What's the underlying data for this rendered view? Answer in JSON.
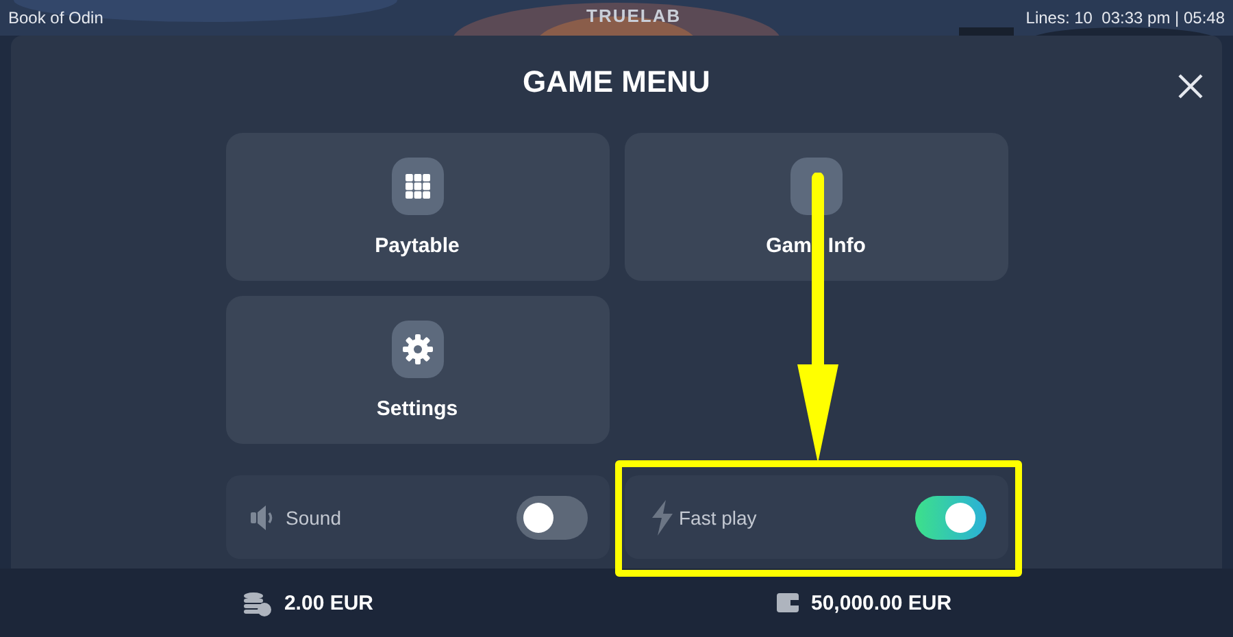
{
  "header": {
    "game_title": "Book of Odin",
    "logo": "TRUELAB",
    "status": "Lines: 10  03:33 pm | 05:48"
  },
  "menu": {
    "title": "GAME MENU",
    "items": [
      {
        "label": "Paytable",
        "kind": "grid"
      },
      {
        "label_parts": [
          "Gam",
          "Info"
        ],
        "kind": "blank"
      },
      {
        "label": "Settings",
        "kind": "gear"
      }
    ]
  },
  "toggles": [
    {
      "label": "Sound",
      "kind": "sound",
      "on": false,
      "highlighted": false
    },
    {
      "label": "Fast play",
      "kind": "bolt",
      "on": true,
      "highlighted": true
    }
  ],
  "footer": {
    "bet": "2.00 EUR",
    "balance": "50,000.00 EUR"
  }
}
